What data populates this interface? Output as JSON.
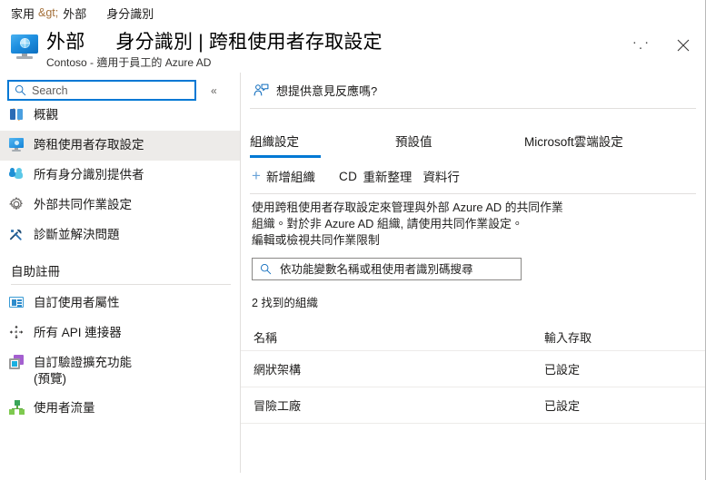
{
  "breadcrumb": {
    "home": "家用",
    "separator": "&gt;",
    "parent": "外部",
    "current": "身分識別"
  },
  "header": {
    "title_prefix": "外部",
    "title_main": "身分識別 | 跨租使用者存取設定",
    "subtitle": "Contoso - 適用于員工的 Azure AD",
    "more_label": "· · ·",
    "close_label": "✕"
  },
  "sidebar": {
    "search": {
      "placeholder": "Search",
      "value": ""
    },
    "collapse_label": "«",
    "items": [
      {
        "label": "概觀",
        "icon": "overview-icon",
        "selected": false
      },
      {
        "label": "跨租使用者存取設定",
        "icon": "monitor-icon",
        "selected": true
      },
      {
        "label": "所有身分識別提供者",
        "icon": "people-icon",
        "selected": false
      },
      {
        "label": "外部共同作業設定",
        "icon": "gear-icon",
        "selected": false
      },
      {
        "label": "診斷並解決問題",
        "icon": "tools-icon",
        "selected": false
      }
    ],
    "section_title": "自助註冊",
    "section_items": [
      {
        "label": "自訂使用者屬性",
        "icon": "id-card-icon"
      },
      {
        "label": "所有 API 連接器",
        "icon": "move-icon"
      },
      {
        "label": "自訂驗證擴充功能\n(預覽)",
        "icon": "layers-icon"
      },
      {
        "label": "使用者流量",
        "icon": "tree-icon"
      }
    ]
  },
  "main": {
    "feedback_label": "想提供意見反應嗎?",
    "tabs": [
      {
        "label": "組織設定",
        "active": true
      },
      {
        "label": "預設值",
        "active": false
      },
      {
        "label": "Microsoft雲端設定",
        "active": false
      }
    ],
    "toolbar": {
      "add_org_label": "新增組織",
      "add_org_glyph": "+",
      "refresh_glyph": "CD",
      "refresh_label": "重新整理",
      "columns_label": "資料行"
    },
    "description": {
      "line1": "使用跨租使用者存取設定來管理與外部 Azure AD 的共同作業",
      "line2": "組織。對於非 Azure AD 組織, 請使用共同作業設定。",
      "link": "編輯或檢視共同作業限制"
    },
    "filter": {
      "placeholder": "依功能變數名稱或租使用者識別碼搜尋",
      "value": ""
    },
    "result_count": "2 找到的組織",
    "table": {
      "columns": [
        "名稱",
        "輸入存取"
      ],
      "rows": [
        {
          "name": "網狀架構",
          "inbound": "已設定"
        },
        {
          "name": "冒險工廠",
          "inbound": "已設定"
        }
      ]
    }
  },
  "colors": {
    "accent": "#0078d4",
    "selection": "#edebe9",
    "divider": "#e1dfdd",
    "breadcrumb_separator": "#a4703a"
  }
}
